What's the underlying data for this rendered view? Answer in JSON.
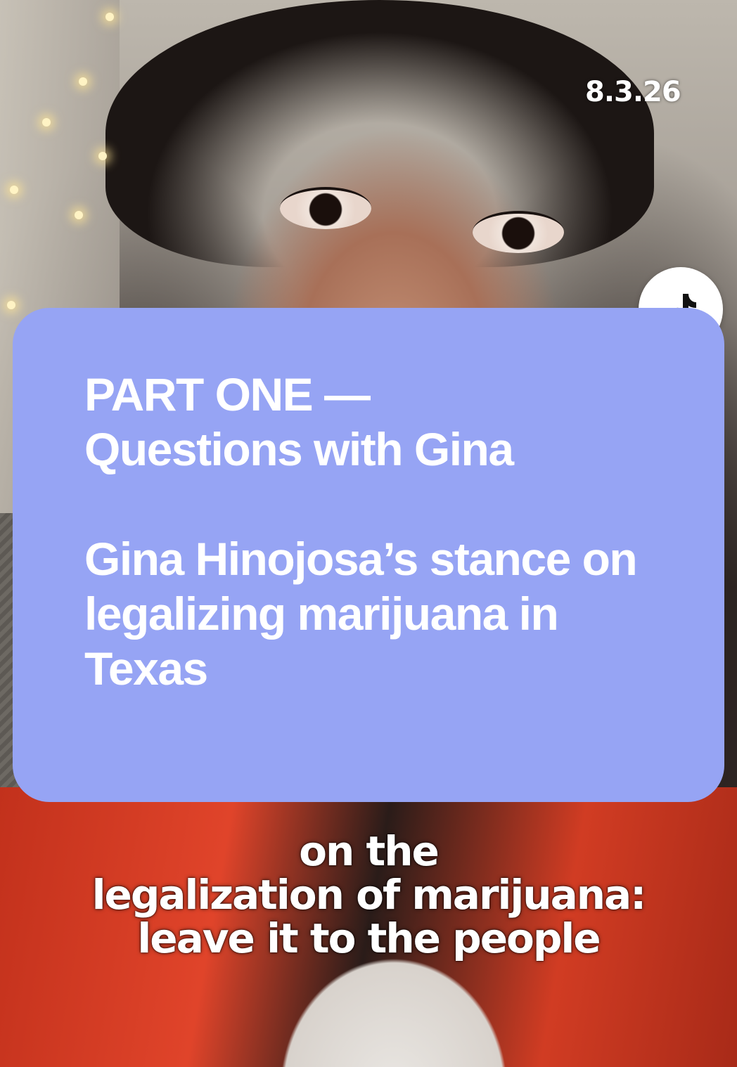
{
  "overlay": {
    "date": "8.3.26",
    "watermark_icon": "tiktok-icon"
  },
  "card": {
    "heading_line1": "PART ONE —",
    "heading_line2": "Questions with Gina",
    "body": "Gina Hinojosa’s stance on legalizing marijuana in Texas",
    "background": "#96a4f4"
  },
  "caption": {
    "line1": "on the",
    "line2": "legalization of marijuana:",
    "line3": "leave it to the people"
  }
}
